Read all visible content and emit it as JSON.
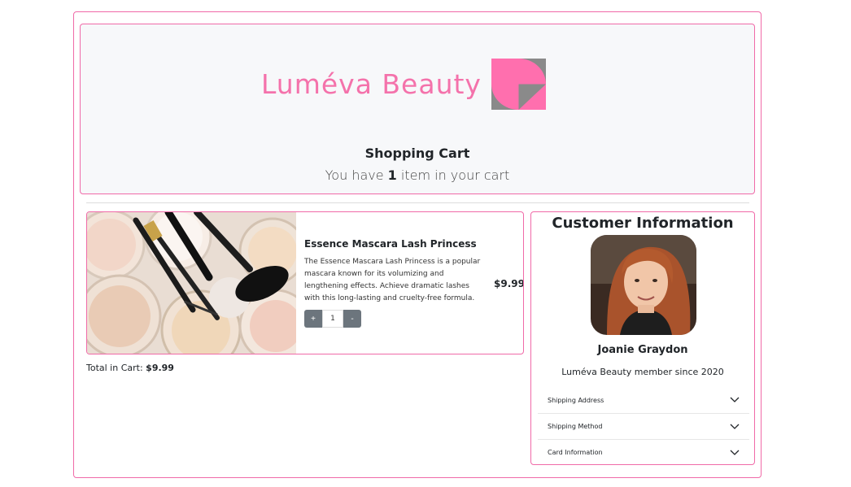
{
  "brand": {
    "name": "Luméva Beauty",
    "color": "#f472ab",
    "logo_icon": "logo-mark-icon"
  },
  "cart": {
    "title": "Shopping Cart",
    "sub_prefix": "You have ",
    "count": "1",
    "sub_suffix": " item in your cart"
  },
  "product": {
    "name": "Essence Mascara Lash Princess",
    "description": "The Essence Mascara Lash Princess is a popular mascara known for its volumizing and lengthening effects. Achieve dramatic lashes with this long-lasting and cruelty-free formula.",
    "price": "$9.99",
    "quantity": "1",
    "plus_label": "+",
    "minus_label": "-",
    "image_icon": "product-photo"
  },
  "total": {
    "label": "Total in Cart: ",
    "value": "$9.99"
  },
  "customer": {
    "title": "Customer Information",
    "name": "Joanie Graydon",
    "member_text": "Luméva Beauty member since 2020",
    "avatar_icon": "avatar-photo",
    "sections": [
      {
        "label": "Shipping Address",
        "icon": "chevron-down-icon"
      },
      {
        "label": "Shipping Method",
        "icon": "chevron-down-icon"
      },
      {
        "label": "Card Information",
        "icon": "chevron-down-icon"
      }
    ]
  },
  "colors": {
    "accent": "#f06aa8",
    "button": "#6c757d",
    "header_bg": "#f7f8fa"
  }
}
